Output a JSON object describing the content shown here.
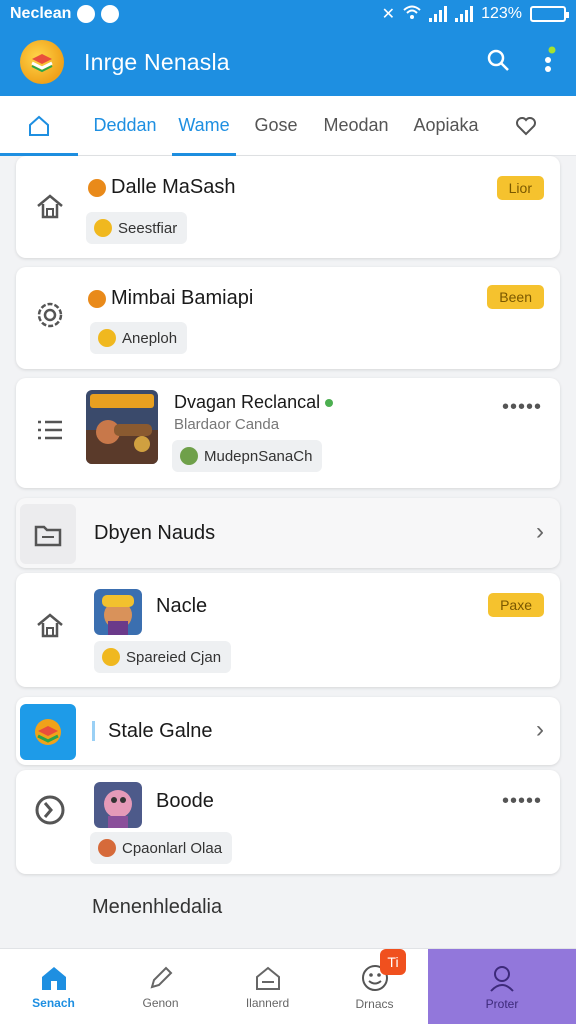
{
  "status": {
    "carrier": "Neclean",
    "battery": "123%"
  },
  "appbar": {
    "title": "Inrge Nenasla"
  },
  "tabs": [
    {
      "label": "Deddan"
    },
    {
      "label": "Wame"
    },
    {
      "label": "Gose"
    },
    {
      "label": "Meodan"
    },
    {
      "label": "Aopiaka"
    }
  ],
  "cards": [
    {
      "title": "Dalle MaSash",
      "pill": "Seestfiar",
      "badge": "Lior"
    },
    {
      "title": "Mimbai Bamiapi",
      "pill": "Aneploh",
      "badge": "Been"
    },
    {
      "title": "Dvagan Reclancal",
      "subtitle": "Blardaor Canda",
      "pill": "MudepnSanaCh"
    },
    {
      "title": "Dbyen Nauds"
    },
    {
      "title": "Nacle",
      "pill": "Spareied Cjan",
      "badge": "Paxe"
    },
    {
      "title": "Stale Galne"
    },
    {
      "title": "Boode",
      "pill": "Cpaonlarl Olaa"
    }
  ],
  "footer_text": "Menenhledalia",
  "nav": [
    {
      "label": "Senach"
    },
    {
      "label": "Genon"
    },
    {
      "label": "Ilannerd"
    },
    {
      "label": "Drnacs",
      "badge": "Ti"
    },
    {
      "label": "Proter"
    }
  ],
  "colors": {
    "primary": "#1e8fe1",
    "badge": "#f5c22e",
    "profile": "#9277db"
  }
}
